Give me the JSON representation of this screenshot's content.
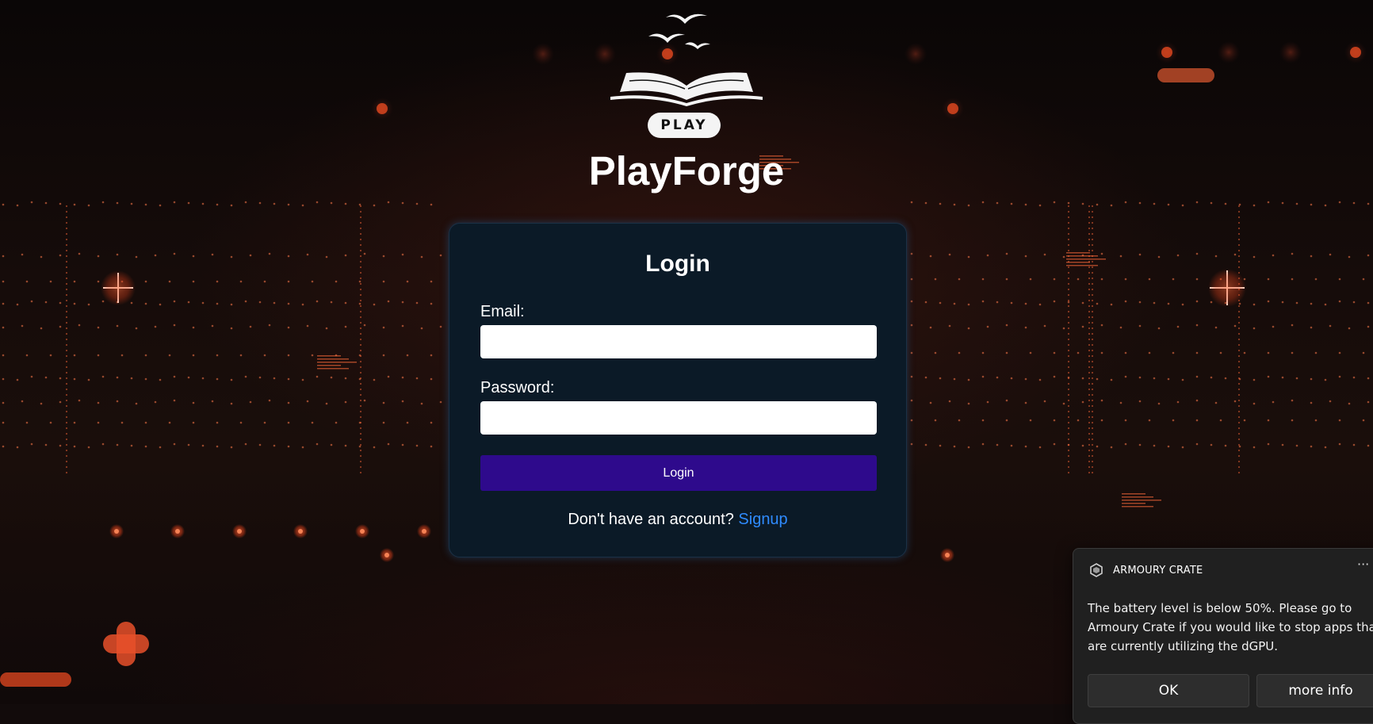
{
  "brand": {
    "badge": "PLAY",
    "title": "PlayForge"
  },
  "login_form": {
    "title": "Login",
    "email_label": "Email:",
    "email_value": "",
    "password_label": "Password:",
    "password_value": "",
    "submit_label": "Login",
    "signup_prompt": "Don't have an account?",
    "signup_link": "Signup"
  },
  "notification": {
    "app_name": "ARMOURY CRATE",
    "more_glyph": "···",
    "message": "The battery level is below 50%. Please go to Armoury Crate if you would like to stop apps that are currently utilizing the dGPU.",
    "ok_label": "OK",
    "more_info_label": "more info"
  },
  "colors": {
    "card_background": "#0b1a27",
    "login_button": "#2e0a8c",
    "signup_link": "#2f8bff",
    "accent_glow": "#ff5a2a"
  }
}
